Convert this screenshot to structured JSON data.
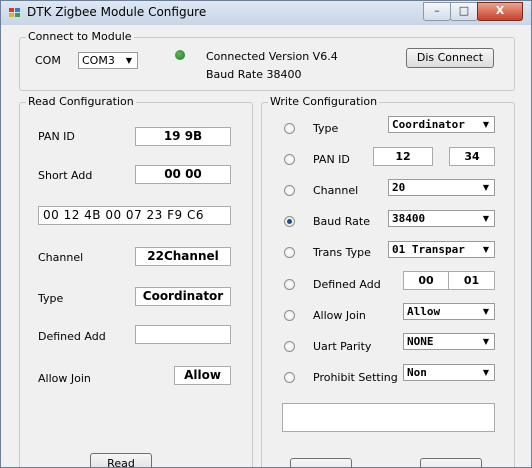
{
  "window": {
    "title": "DTK Zigbee Module Configure",
    "min_glyph": "–",
    "max_glyph": "□",
    "close_glyph": "X"
  },
  "connect": {
    "legend": "Connect to Module",
    "com_label": "COM",
    "com_value": "COM3",
    "version_text": "Connected Version V6.4",
    "baud_text": "Baud Rate 38400",
    "disconnect_label": "Dis Connect",
    "led_color": "#1e8a1e"
  },
  "read": {
    "legend": "Read Configuration",
    "pan_id_label": "PAN ID",
    "pan_id_value": "19 9B",
    "short_add_label": "Short Add",
    "short_add_value": "00 00",
    "mac_value": "00 12 4B 00 07 23 F9 C6",
    "channel_label": "Channel",
    "channel_value": "22Channel",
    "type_label": "Type",
    "type_value": "Coordinator",
    "defined_add_label": "Defined Add",
    "defined_add_value": "",
    "allow_join_label": "Allow Join",
    "allow_join_value": "Allow",
    "read_button": "Read"
  },
  "write": {
    "legend": "Write Configuration",
    "type_label": "Type",
    "type_value": "Coordinator",
    "pan_id_label": "PAN ID",
    "pan_id_1": "12",
    "pan_id_2": "34",
    "channel_label": "Channel",
    "channel_value": "20",
    "baud_label": "Baud Rate",
    "baud_value": "38400",
    "trans_label": "Trans Type",
    "trans_value": "01 Transpar",
    "defined_add_label": "Defined Add",
    "defined_add_1": "00",
    "defined_add_2": "01",
    "allow_join_label": "Allow Join",
    "allow_join_value": "Allow",
    "uart_parity_label": "Uart Parity",
    "uart_parity_value": "NONE",
    "prohibit_label": "Prohibit Setting",
    "prohibit_value": "Non",
    "selected_option": "Baud Rate",
    "status_text": ""
  },
  "colors": {
    "accent": "#1a4d8f",
    "led": "#1e8a1e",
    "close": "#c8402a"
  },
  "icons": {
    "combo_arrow": "▼"
  }
}
